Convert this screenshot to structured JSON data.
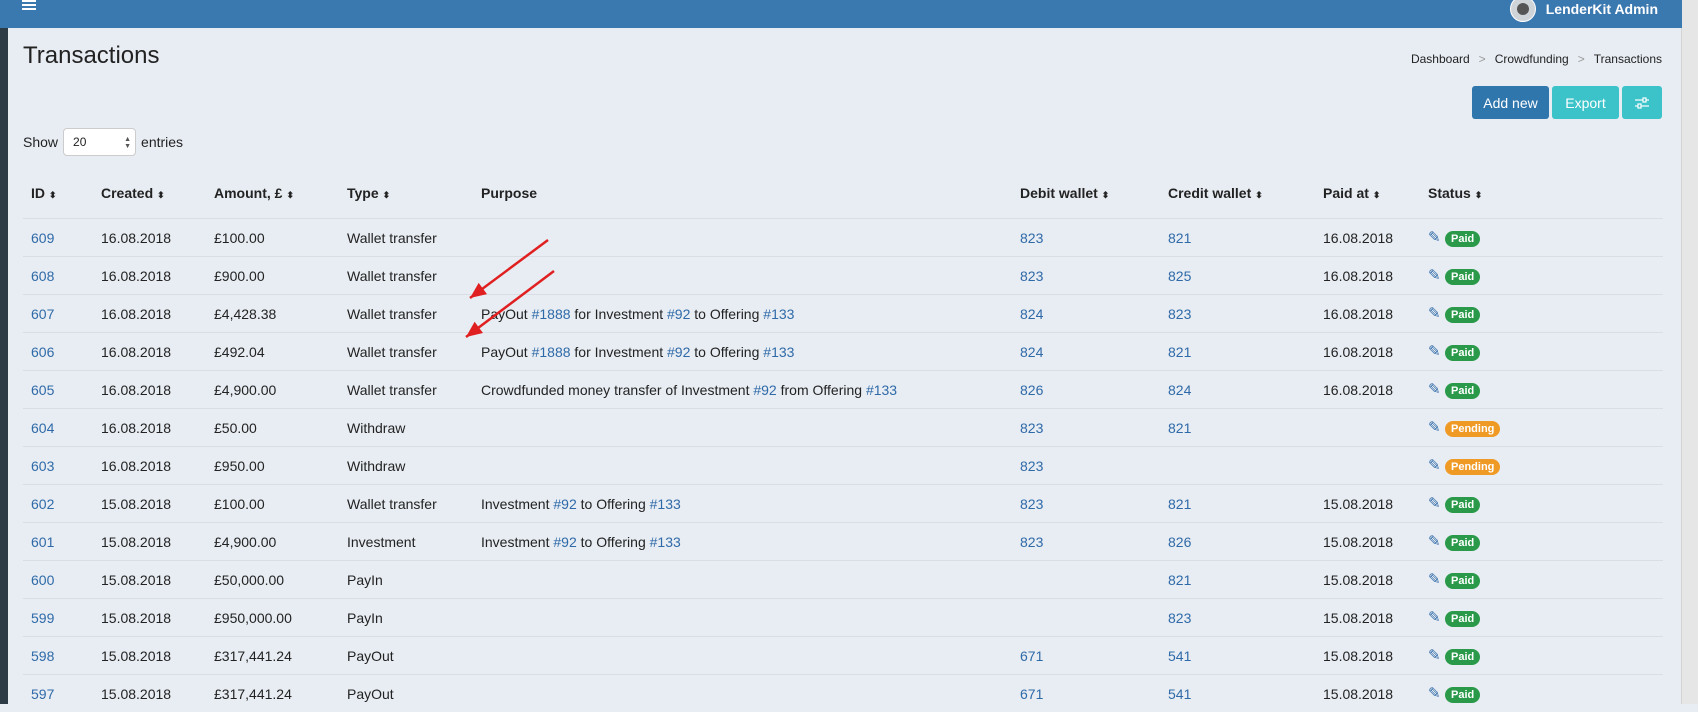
{
  "header": {
    "user_name": "LenderKit Admin"
  },
  "page": {
    "title": "Transactions"
  },
  "breadcrumb": {
    "items": [
      "Dashboard",
      "Crowdfunding",
      "Transactions"
    ],
    "separator": ">"
  },
  "actions": {
    "add_label": "Add new",
    "export_label": "Export"
  },
  "entries": {
    "show_label": "Show",
    "value": "20",
    "suffix": "entries"
  },
  "table": {
    "columns": [
      "ID",
      "Created",
      "Amount, £",
      "Type",
      "Purpose",
      "Debit wallet",
      "Credit wallet",
      "Paid at",
      "Status"
    ],
    "rows": [
      {
        "id": "609",
        "created": "16.08.2018",
        "amount": "£100.00",
        "type": "Wallet transfer",
        "purpose": [],
        "debit": "823",
        "credit": "821",
        "paid_at": "16.08.2018",
        "status": "Paid"
      },
      {
        "id": "608",
        "created": "16.08.2018",
        "amount": "£900.00",
        "type": "Wallet transfer",
        "purpose": [],
        "debit": "823",
        "credit": "825",
        "paid_at": "16.08.2018",
        "status": "Paid"
      },
      {
        "id": "607",
        "created": "16.08.2018",
        "amount": "£4,428.38",
        "type": "Wallet transfer",
        "purpose": [
          {
            "t": "PayOut "
          },
          {
            "l": "#1888"
          },
          {
            "t": " for Investment "
          },
          {
            "l": "#92"
          },
          {
            "t": " to Offering "
          },
          {
            "l": "#133"
          }
        ],
        "debit": "824",
        "credit": "823",
        "paid_at": "16.08.2018",
        "status": "Paid"
      },
      {
        "id": "606",
        "created": "16.08.2018",
        "amount": "£492.04",
        "type": "Wallet transfer",
        "purpose": [
          {
            "t": "PayOut "
          },
          {
            "l": "#1888"
          },
          {
            "t": " for Investment "
          },
          {
            "l": "#92"
          },
          {
            "t": " to Offering "
          },
          {
            "l": "#133"
          }
        ],
        "debit": "824",
        "credit": "821",
        "paid_at": "16.08.2018",
        "status": "Paid"
      },
      {
        "id": "605",
        "created": "16.08.2018",
        "amount": "£4,900.00",
        "type": "Wallet transfer",
        "purpose": [
          {
            "t": "Crowdfunded money transfer of Investment "
          },
          {
            "l": "#92"
          },
          {
            "t": " from Offering "
          },
          {
            "l": "#133"
          }
        ],
        "debit": "826",
        "credit": "824",
        "paid_at": "16.08.2018",
        "status": "Paid"
      },
      {
        "id": "604",
        "created": "16.08.2018",
        "amount": "£50.00",
        "type": "Withdraw",
        "purpose": [],
        "debit": "823",
        "credit": "821",
        "paid_at": "",
        "status": "Pending"
      },
      {
        "id": "603",
        "created": "16.08.2018",
        "amount": "£950.00",
        "type": "Withdraw",
        "purpose": [],
        "debit": "823",
        "credit": "",
        "paid_at": "",
        "status": "Pending"
      },
      {
        "id": "602",
        "created": "15.08.2018",
        "amount": "£100.00",
        "type": "Wallet transfer",
        "purpose": [
          {
            "t": "Investment "
          },
          {
            "l": "#92"
          },
          {
            "t": " to Offering "
          },
          {
            "l": "#133"
          }
        ],
        "debit": "823",
        "credit": "821",
        "paid_at": "15.08.2018",
        "status": "Paid"
      },
      {
        "id": "601",
        "created": "15.08.2018",
        "amount": "£4,900.00",
        "type": "Investment",
        "purpose": [
          {
            "t": "Investment "
          },
          {
            "l": "#92"
          },
          {
            "t": " to Offering "
          },
          {
            "l": "#133"
          }
        ],
        "debit": "823",
        "credit": "826",
        "paid_at": "15.08.2018",
        "status": "Paid"
      },
      {
        "id": "600",
        "created": "15.08.2018",
        "amount": "£50,000.00",
        "type": "PayIn",
        "purpose": [],
        "debit": "",
        "credit": "821",
        "paid_at": "15.08.2018",
        "status": "Paid"
      },
      {
        "id": "599",
        "created": "15.08.2018",
        "amount": "£950,000.00",
        "type": "PayIn",
        "purpose": [],
        "debit": "",
        "credit": "823",
        "paid_at": "15.08.2018",
        "status": "Paid"
      },
      {
        "id": "598",
        "created": "15.08.2018",
        "amount": "£317,441.24",
        "type": "PayOut",
        "purpose": [],
        "debit": "671",
        "credit": "541",
        "paid_at": "15.08.2018",
        "status": "Paid"
      },
      {
        "id": "597",
        "created": "15.08.2018",
        "amount": "£317,441.24",
        "type": "PayOut",
        "purpose": [],
        "debit": "671",
        "credit": "541",
        "paid_at": "15.08.2018",
        "status": "Paid"
      }
    ]
  },
  "annotations": {
    "arrow_color": "#e02020"
  }
}
